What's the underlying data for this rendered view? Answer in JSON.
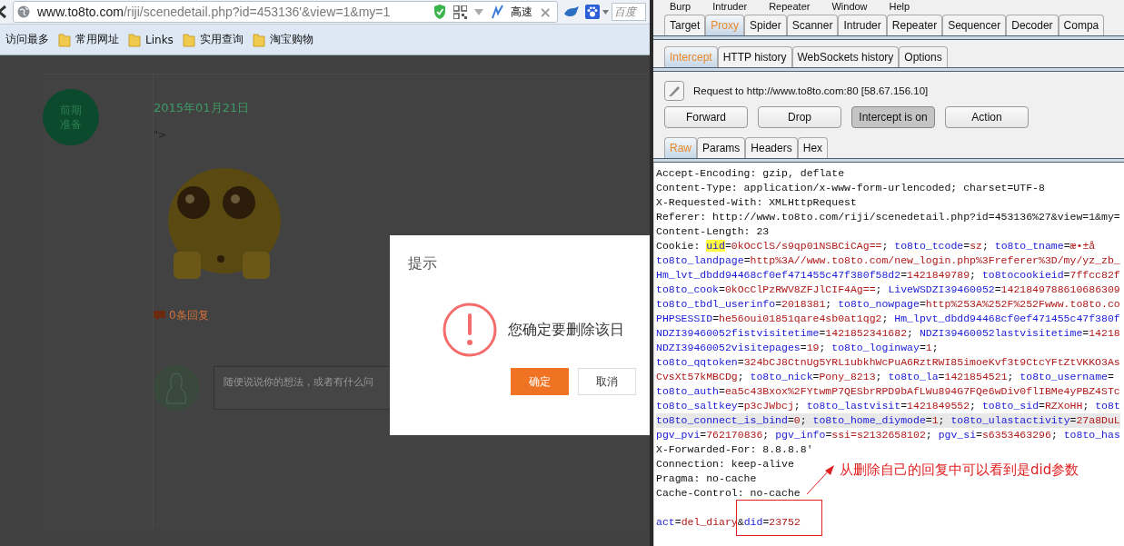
{
  "browser": {
    "address": {
      "host": "www.to8to.com",
      "path": "/riji/scenedetail.php?id=453136'&view=1&my=1"
    },
    "speed_label": "高速",
    "close_label": "×",
    "search": {
      "placeholder": "百度"
    }
  },
  "bookmarks": [
    {
      "label": "访问最多",
      "kind": "plain"
    },
    {
      "label": "常用网址",
      "kind": "folder"
    },
    {
      "label": "Links",
      "kind": "folder"
    },
    {
      "label": "实用查询",
      "kind": "folder"
    },
    {
      "label": "淘宝购物",
      "kind": "folder"
    }
  ],
  "page": {
    "stage_badge": [
      "前期",
      "准备"
    ],
    "date": "2015年01月21日",
    "body_text": "\">",
    "reply_count": "0条回复",
    "comment_field": {
      "placeholder": "随便说说你的想法，或者有什么问"
    }
  },
  "dialog": {
    "title": "提示",
    "message": "您确定要删除该日",
    "buttons": [
      {
        "label": "确定",
        "kind": "primary"
      },
      {
        "label": "取消",
        "kind": "secondary"
      }
    ]
  },
  "burp": {
    "menu": [
      "Burp",
      "Intruder",
      "Repeater",
      "Window",
      "Help"
    ],
    "tabs": [
      {
        "label": "Target",
        "selected": false
      },
      {
        "label": "Proxy",
        "selected": true
      },
      {
        "label": "Spider",
        "selected": false
      },
      {
        "label": "Scanner",
        "selected": false
      },
      {
        "label": "Intruder",
        "selected": false
      },
      {
        "label": "Repeater",
        "selected": false
      },
      {
        "label": "Sequencer",
        "selected": false
      },
      {
        "label": "Decoder",
        "selected": false
      },
      {
        "label": "Compa",
        "selected": false
      }
    ],
    "subtabs": [
      {
        "label": "Intercept",
        "selected": true
      },
      {
        "label": "HTTP history",
        "selected": false
      },
      {
        "label": "WebSockets history",
        "selected": false
      },
      {
        "label": "Options",
        "selected": false
      }
    ],
    "request_info": "Request to http://www.to8to.com:80  [58.67.156.10]",
    "buttons": [
      {
        "label": "Forward",
        "on": false
      },
      {
        "label": "Drop",
        "on": false
      },
      {
        "label": "Intercept is on",
        "on": true
      },
      {
        "label": "Action",
        "on": false
      }
    ],
    "view_tabs": [
      {
        "label": "Raw",
        "selected": true
      },
      {
        "label": "Params",
        "selected": false
      },
      {
        "label": "Headers",
        "selected": false
      },
      {
        "label": "Hex",
        "selected": false
      }
    ],
    "request_lines": [
      {
        "current": false,
        "segments": [
          {
            "text": "Accept-Encoding: gzip, deflate",
            "kind": "plain"
          }
        ]
      },
      {
        "current": false,
        "segments": [
          {
            "text": "Content-Type: application/x-www-form-urlencoded; charset=UTF-8",
            "kind": "plain"
          }
        ]
      },
      {
        "current": false,
        "segments": [
          {
            "text": "X-Requested-With: XMLHttpRequest",
            "kind": "plain"
          }
        ]
      },
      {
        "current": false,
        "segments": [
          {
            "text": "Referer: http://www.to8to.com/riji/scenedetail.php?id=453136%27&view=1&my=",
            "kind": "plain"
          }
        ]
      },
      {
        "current": false,
        "segments": [
          {
            "text": "Content-Length: 23",
            "kind": "plain"
          }
        ]
      },
      {
        "current": false,
        "segments": [
          {
            "text": "Cookie: ",
            "kind": "plain"
          },
          {
            "text": "uid",
            "kind": "match"
          },
          {
            "text": "=",
            "kind": "plain"
          },
          {
            "text": "0kOcClS/s9qp01NSBCiCAg==",
            "kind": "value"
          },
          {
            "text": "; ",
            "kind": "plain"
          },
          {
            "text": "to8to_tcode",
            "kind": "name"
          },
          {
            "text": "=",
            "kind": "plain"
          },
          {
            "text": "sz",
            "kind": "value"
          },
          {
            "text": "; ",
            "kind": "plain"
          },
          {
            "text": "to8to_tname",
            "kind": "name"
          },
          {
            "text": "=",
            "kind": "plain"
          },
          {
            "text": "æ•±å",
            "kind": "value"
          }
        ]
      },
      {
        "current": false,
        "segments": [
          {
            "text": "to8to_landpage",
            "kind": "name"
          },
          {
            "text": "=",
            "kind": "plain"
          },
          {
            "text": "http%3A//www.to8to.com/new_login.php%3Freferer%3D/my/yz_zb_",
            "kind": "value"
          }
        ]
      },
      {
        "current": false,
        "segments": [
          {
            "text": "Hm_lvt_dbdd94468cf0ef471455c47f380f58d2",
            "kind": "name"
          },
          {
            "text": "=",
            "kind": "plain"
          },
          {
            "text": "1421849789",
            "kind": "value"
          },
          {
            "text": "; ",
            "kind": "plain"
          },
          {
            "text": "to8tocookieid",
            "kind": "name"
          },
          {
            "text": "=",
            "kind": "plain"
          },
          {
            "text": "7ffcc82f",
            "kind": "value"
          }
        ]
      },
      {
        "current": false,
        "segments": [
          {
            "text": "to8to_cook",
            "kind": "name"
          },
          {
            "text": "=",
            "kind": "plain"
          },
          {
            "text": "0kOcClPzRWV8ZFJlCIF4Ag==",
            "kind": "value"
          },
          {
            "text": "; ",
            "kind": "plain"
          },
          {
            "text": "LiveWSDZI39460052",
            "kind": "name"
          },
          {
            "text": "=",
            "kind": "plain"
          },
          {
            "text": "1421849788610686309",
            "kind": "value"
          }
        ]
      },
      {
        "current": false,
        "segments": [
          {
            "text": "to8to_tbdl_userinfo",
            "kind": "name"
          },
          {
            "text": "=",
            "kind": "plain"
          },
          {
            "text": "2018381",
            "kind": "value"
          },
          {
            "text": "; ",
            "kind": "plain"
          },
          {
            "text": "to8to_nowpage",
            "kind": "name"
          },
          {
            "text": "=",
            "kind": "plain"
          },
          {
            "text": "http%253A%252F%252Fwww.to8to.co",
            "kind": "value"
          }
        ]
      },
      {
        "current": false,
        "segments": [
          {
            "text": "PHPSESSID",
            "kind": "name"
          },
          {
            "text": "=",
            "kind": "plain"
          },
          {
            "text": "he56oui01851qare4sb0at1qg2",
            "kind": "value"
          },
          {
            "text": "; ",
            "kind": "plain"
          },
          {
            "text": "Hm_lpvt_dbdd94468cf0ef471455c47f380f",
            "kind": "name"
          }
        ]
      },
      {
        "current": false,
        "segments": [
          {
            "text": "NDZI39460052fistvisitetime",
            "kind": "name"
          },
          {
            "text": "=",
            "kind": "plain"
          },
          {
            "text": "1421852341682",
            "kind": "value"
          },
          {
            "text": "; ",
            "kind": "plain"
          },
          {
            "text": "NDZI39460052lastvisitetime",
            "kind": "name"
          },
          {
            "text": "=",
            "kind": "plain"
          },
          {
            "text": "14218",
            "kind": "value"
          }
        ]
      },
      {
        "current": false,
        "segments": [
          {
            "text": "NDZI39460052visitepages",
            "kind": "name"
          },
          {
            "text": "=",
            "kind": "plain"
          },
          {
            "text": "19",
            "kind": "value"
          },
          {
            "text": "; ",
            "kind": "plain"
          },
          {
            "text": "to8to_loginway",
            "kind": "name"
          },
          {
            "text": "=",
            "kind": "plain"
          },
          {
            "text": "1",
            "kind": "value"
          },
          {
            "text": ";",
            "kind": "plain"
          }
        ]
      },
      {
        "current": false,
        "segments": [
          {
            "text": "to8to_qqtoken",
            "kind": "name"
          },
          {
            "text": "=",
            "kind": "plain"
          },
          {
            "text": "324bCJ8CtnUg5YRL1ubkhWcPuA6RztRWI85imoeKvf3t9CtcYFtZtVKKO3As",
            "kind": "value"
          }
        ]
      },
      {
        "current": false,
        "segments": [
          {
            "text": "CvsXt57kMBCDg",
            "kind": "value"
          },
          {
            "text": "; ",
            "kind": "plain"
          },
          {
            "text": "to8to_nick",
            "kind": "name"
          },
          {
            "text": "=",
            "kind": "plain"
          },
          {
            "text": "Pony_8213",
            "kind": "value"
          },
          {
            "text": "; ",
            "kind": "plain"
          },
          {
            "text": "to8to_la",
            "kind": "name"
          },
          {
            "text": "=",
            "kind": "plain"
          },
          {
            "text": "1421854521",
            "kind": "value"
          },
          {
            "text": "; ",
            "kind": "plain"
          },
          {
            "text": "to8to_username",
            "kind": "name"
          },
          {
            "text": "=",
            "kind": "plain"
          }
        ]
      },
      {
        "current": false,
        "segments": [
          {
            "text": "to8to_auth",
            "kind": "name"
          },
          {
            "text": "=",
            "kind": "plain"
          },
          {
            "text": "ea5c43Bxox%2FYtwmP7QESbrRPD9bAfLWu894G7FQe6wDiv0flIBMe4yPBZ4STc",
            "kind": "value"
          }
        ]
      },
      {
        "current": false,
        "segments": [
          {
            "text": "to8to_saltkey",
            "kind": "name"
          },
          {
            "text": "=",
            "kind": "plain"
          },
          {
            "text": "p3cJWbcj",
            "kind": "value"
          },
          {
            "text": "; ",
            "kind": "plain"
          },
          {
            "text": "to8to_lastvisit",
            "kind": "name"
          },
          {
            "text": "=",
            "kind": "plain"
          },
          {
            "text": "1421849552",
            "kind": "value"
          },
          {
            "text": "; ",
            "kind": "plain"
          },
          {
            "text": "to8to_sid",
            "kind": "name"
          },
          {
            "text": "=",
            "kind": "plain"
          },
          {
            "text": "RZXoHH",
            "kind": "value"
          },
          {
            "text": "; ",
            "kind": "plain"
          },
          {
            "text": "to8t",
            "kind": "name"
          }
        ]
      },
      {
        "current": true,
        "segments": [
          {
            "text": "to8to_connect_is_bind",
            "kind": "name"
          },
          {
            "text": "=",
            "kind": "plain"
          },
          {
            "text": "0",
            "kind": "value"
          },
          {
            "text": "; ",
            "kind": "plain"
          },
          {
            "text": "to8to_home_diymode",
            "kind": "name"
          },
          {
            "text": "=",
            "kind": "plain"
          },
          {
            "text": "1",
            "kind": "value"
          },
          {
            "text": "; ",
            "kind": "plain"
          },
          {
            "text": "to8to_ulastactivity",
            "kind": "name"
          },
          {
            "text": "=",
            "kind": "plain"
          },
          {
            "text": "27a8DuL",
            "kind": "value"
          }
        ]
      },
      {
        "current": false,
        "segments": [
          {
            "text": "pgv_pvi",
            "kind": "name"
          },
          {
            "text": "=",
            "kind": "plain"
          },
          {
            "text": "762170836",
            "kind": "value"
          },
          {
            "text": "; ",
            "kind": "plain"
          },
          {
            "text": "pgv_info",
            "kind": "name"
          },
          {
            "text": "=",
            "kind": "plain"
          },
          {
            "text": "ssi=s2132658102",
            "kind": "value"
          },
          {
            "text": "; ",
            "kind": "plain"
          },
          {
            "text": "pgv_si",
            "kind": "name"
          },
          {
            "text": "=",
            "kind": "plain"
          },
          {
            "text": "s6353463296",
            "kind": "value"
          },
          {
            "text": "; ",
            "kind": "plain"
          },
          {
            "text": "to8to_has",
            "kind": "name"
          }
        ]
      },
      {
        "current": false,
        "segments": [
          {
            "text": "X-Forwarded-For: 8.8.8.8'",
            "kind": "plain"
          }
        ]
      },
      {
        "current": false,
        "segments": [
          {
            "text": "Connection: keep-alive",
            "kind": "plain"
          }
        ]
      },
      {
        "current": false,
        "segments": [
          {
            "text": "Pragma: no-cache",
            "kind": "plain"
          }
        ]
      },
      {
        "current": false,
        "segments": [
          {
            "text": "Cache-Control: no-cache",
            "kind": "plain"
          }
        ]
      }
    ],
    "request_body": [
      {
        "segments": [
          {
            "text": "act",
            "kind": "name"
          },
          {
            "text": "=",
            "kind": "plain"
          },
          {
            "text": "del_diary",
            "kind": "value"
          },
          {
            "text": "&",
            "kind": "plain"
          },
          {
            "text": "did",
            "kind": "name"
          },
          {
            "text": "=",
            "kind": "plain"
          },
          {
            "text": "23752",
            "kind": "value"
          }
        ]
      }
    ]
  },
  "annotation": {
    "text": "从删除自己的回复中可以看到是did参数"
  }
}
